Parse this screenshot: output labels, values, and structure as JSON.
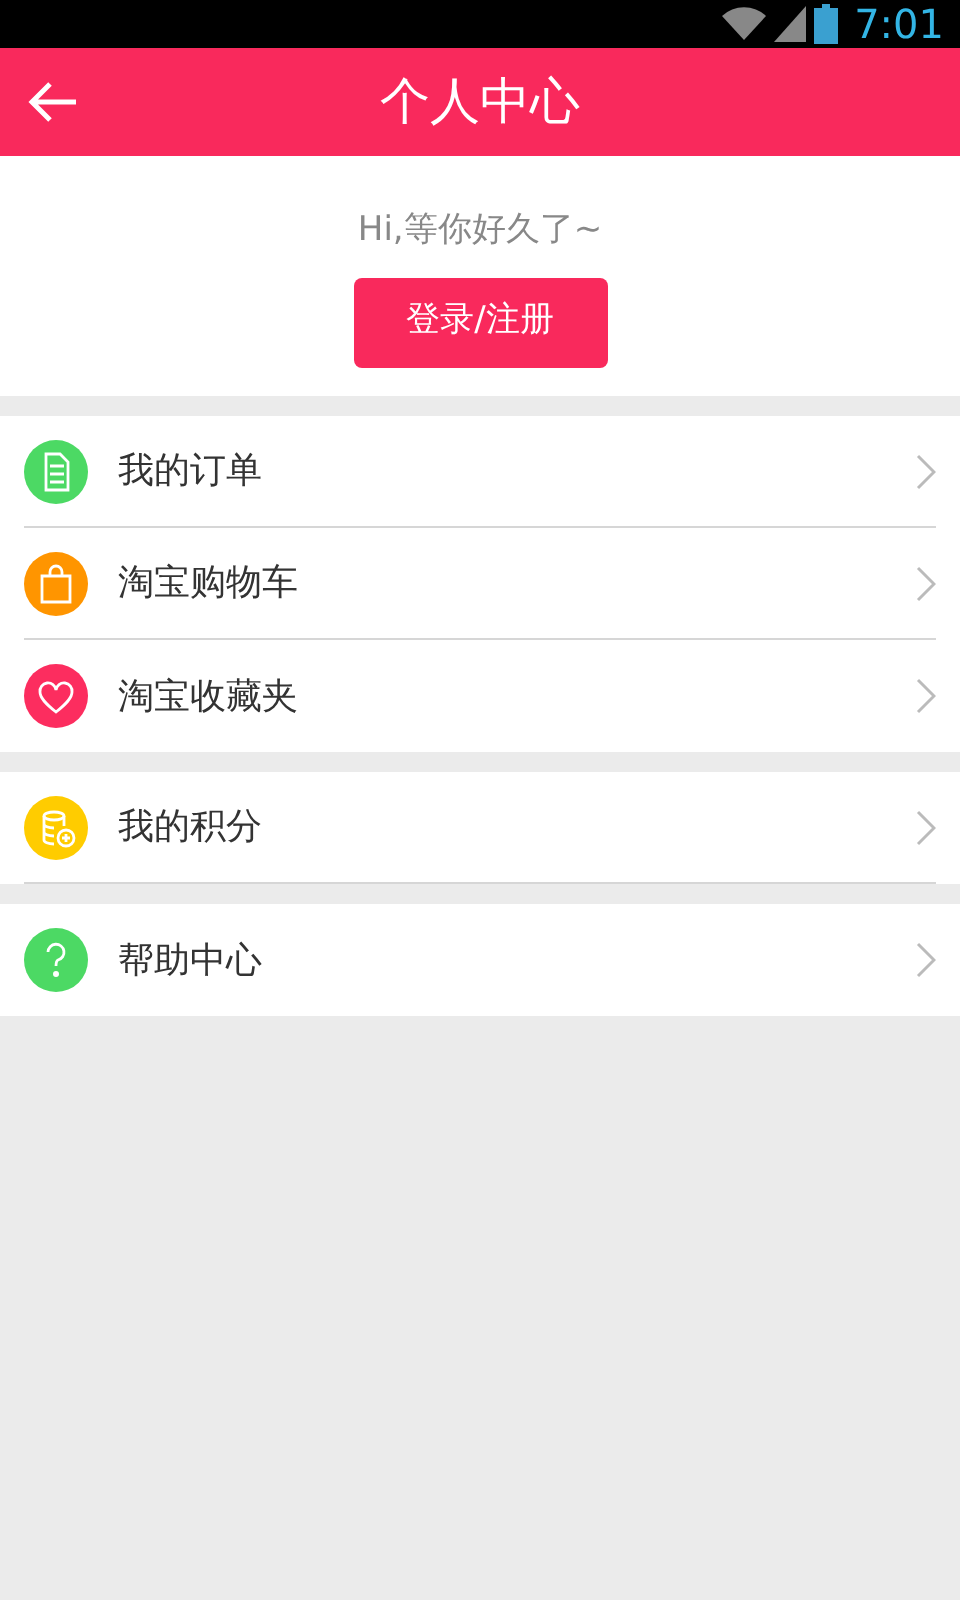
{
  "status_bar": {
    "time": "7:01"
  },
  "header": {
    "title": "个人中心"
  },
  "welcome": {
    "greeting": "Hi,等你好久了~",
    "login_button": "登录/注册"
  },
  "sections": [
    {
      "items": [
        {
          "label": "我的订单",
          "kind": "document",
          "color": "#4cd964"
        },
        {
          "label": "淘宝购物车",
          "kind": "bag",
          "color": "#ff9500"
        },
        {
          "label": "淘宝收藏夹",
          "kind": "heart",
          "color": "#fc2d5f"
        }
      ]
    },
    {
      "items": [
        {
          "label": "我的积分",
          "kind": "coins",
          "color": "#ffcc00"
        }
      ]
    },
    {
      "items": [
        {
          "label": "帮助中心",
          "kind": "question",
          "color": "#4cd964"
        }
      ]
    }
  ]
}
